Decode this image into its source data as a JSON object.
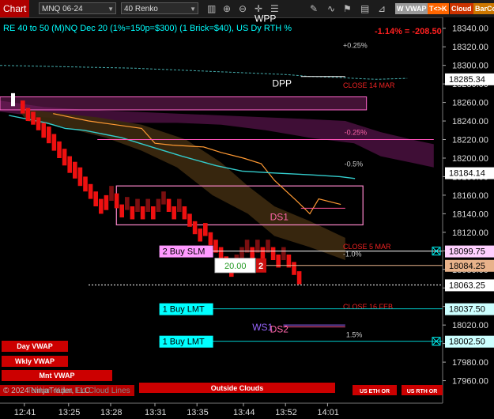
{
  "toolbar": {
    "tab_label": "Chart",
    "instrument": "MNQ 06-24",
    "bar_type": "40 Renko",
    "icons": [
      "bar-chart-icon",
      "zoom-in-icon",
      "zoom-out-icon",
      "crosshair-icon",
      "properties-icon",
      "pencil-icon",
      "indicator-icon",
      "strategy-icon",
      "template-icon",
      "pin-icon"
    ],
    "buttons": [
      {
        "label": "W VWAP",
        "color": "#9a9a9a"
      },
      {
        "label": "T<>K",
        "color": "#ff6600"
      },
      {
        "label": "Cloud",
        "color": "#cc3300"
      },
      {
        "label": "BarCo",
        "color": "#cc7700"
      }
    ]
  },
  "chart_data": {
    "type": "renko",
    "title": "RE 40 to 50 (M)NQ Dec 20 (1%=150p=$300) (1 Brick=$40), US Dy RTH %",
    "change_text": "-1.14% = -208.50",
    "ylim": [
      17940,
      18350
    ],
    "y_ticks": [
      17960,
      17980,
      18000,
      18020,
      18040,
      18060,
      18080,
      18100,
      18120,
      18140,
      18160,
      18180,
      18200,
      18220,
      18240,
      18260,
      18280,
      18300,
      18320,
      18340
    ],
    "x_tick_labels": [
      "12:41",
      "13:25",
      "13:28",
      "13:31",
      "13:35",
      "13:44",
      "13:52",
      "14:01"
    ],
    "bricks": [
      {
        "o": 18262,
        "c": 18248,
        "color": "red"
      },
      {
        "o": 18254,
        "c": 18240,
        "color": "red"
      },
      {
        "o": 18250,
        "c": 18236,
        "color": "red"
      },
      {
        "o": 18244,
        "c": 18230,
        "color": "red"
      },
      {
        "o": 18238,
        "c": 18222,
        "color": "red"
      },
      {
        "o": 18234,
        "c": 18216,
        "color": "red"
      },
      {
        "o": 18226,
        "c": 18208,
        "color": "red"
      },
      {
        "o": 18218,
        "c": 18200,
        "color": "red"
      },
      {
        "o": 18210,
        "c": 18192,
        "color": "red"
      },
      {
        "o": 18202,
        "c": 18184,
        "color": "red"
      },
      {
        "o": 18196,
        "c": 18178,
        "color": "red"
      },
      {
        "o": 18190,
        "c": 18170,
        "color": "red"
      },
      {
        "o": 18180,
        "c": 18164,
        "color": "red"
      },
      {
        "o": 18172,
        "c": 18156,
        "color": "red"
      },
      {
        "o": 18164,
        "c": 18148,
        "color": "red"
      },
      {
        "o": 18156,
        "c": 18140,
        "color": "red"
      },
      {
        "o": 18160,
        "c": 18144,
        "color": "red"
      },
      {
        "o": 18170,
        "c": 18154,
        "color": "darkred"
      },
      {
        "o": 18162,
        "c": 18146,
        "color": "red"
      },
      {
        "o": 18150,
        "c": 18136,
        "color": "red"
      },
      {
        "o": 18158,
        "c": 18144,
        "color": "darkred"
      },
      {
        "o": 18148,
        "c": 18134,
        "color": "red"
      },
      {
        "o": 18156,
        "c": 18142,
        "color": "darkred"
      },
      {
        "o": 18148,
        "c": 18134,
        "color": "red"
      },
      {
        "o": 18156,
        "c": 18142,
        "color": "darkred"
      },
      {
        "o": 18148,
        "c": 18134,
        "color": "red"
      },
      {
        "o": 18156,
        "c": 18142,
        "color": "darkred"
      },
      {
        "o": 18164,
        "c": 18150,
        "color": "darkred"
      },
      {
        "o": 18156,
        "c": 18142,
        "color": "red"
      },
      {
        "o": 18148,
        "c": 18134,
        "color": "red"
      },
      {
        "o": 18156,
        "c": 18142,
        "color": "darkred"
      },
      {
        "o": 18148,
        "c": 18134,
        "color": "red"
      },
      {
        "o": 18140,
        "c": 18126,
        "color": "red"
      },
      {
        "o": 18132,
        "c": 18118,
        "color": "red"
      },
      {
        "o": 18124,
        "c": 18110,
        "color": "red"
      },
      {
        "o": 18130,
        "c": 18116,
        "color": "red"
      },
      {
        "o": 18120,
        "c": 18106,
        "color": "red"
      },
      {
        "o": 18112,
        "c": 18098,
        "color": "red"
      },
      {
        "o": 18104,
        "c": 18090,
        "color": "red"
      },
      {
        "o": 18094,
        "c": 18080,
        "color": "red"
      },
      {
        "o": 18086,
        "c": 18072,
        "color": "red"
      },
      {
        "o": 18096,
        "c": 18082,
        "color": "darkred"
      },
      {
        "o": 18104,
        "c": 18090,
        "color": "darkred"
      },
      {
        "o": 18112,
        "c": 18098,
        "color": "darkred"
      },
      {
        "o": 18104,
        "c": 18090,
        "color": "red"
      },
      {
        "o": 18112,
        "c": 18098,
        "color": "darkred"
      },
      {
        "o": 18104,
        "c": 18090,
        "color": "red"
      },
      {
        "o": 18112,
        "c": 18098,
        "color": "darkred"
      },
      {
        "o": 18104,
        "c": 18090,
        "color": "red"
      },
      {
        "o": 18096,
        "c": 18082,
        "color": "red"
      },
      {
        "o": 18104,
        "c": 18090,
        "color": "darkred"
      },
      {
        "o": 18096,
        "c": 18082,
        "color": "red"
      },
      {
        "o": 18088,
        "c": 18074,
        "color": "red"
      },
      {
        "o": 18078,
        "c": 18064,
        "color": "red"
      }
    ],
    "price_tags": [
      {
        "price": 18285.34,
        "label": "18285.34",
        "bg": "#ffffff",
        "fg": "#000000"
      },
      {
        "price": 18184.14,
        "label": "18184.14",
        "bg": "#ffffff",
        "fg": "#000000"
      },
      {
        "price": 18099.75,
        "label": "18099.75",
        "bg": "#ffd0ff",
        "fg": "#000000"
      },
      {
        "price": 18084.25,
        "label": "18084.25",
        "bg": "#e8b28a",
        "fg": "#000000"
      },
      {
        "price": 18063.25,
        "label": "18063.25",
        "bg": "#ffffff",
        "fg": "#000000"
      },
      {
        "price": 18037.5,
        "label": "18037.50",
        "bg": "#ccffff",
        "fg": "#000000"
      },
      {
        "price": 18002.5,
        "label": "18002.50",
        "bg": "#ccffff",
        "fg": "#000000"
      }
    ],
    "level_labels": [
      {
        "text": "WPP",
        "price": 18347,
        "x": 0.575,
        "color": "#ffffff"
      },
      {
        "text": "DPP",
        "price": 18277,
        "x": 0.615,
        "color": "#ffffff"
      },
      {
        "text": "DS1",
        "price": 18133,
        "x": 0.61,
        "color": "#ff66aa"
      },
      {
        "text": "WS1",
        "price": 18014,
        "x": 0.57,
        "color": "#9966ff"
      },
      {
        "text": "DS2",
        "price": 18012,
        "x": 0.61,
        "color": "#ff66aa"
      },
      {
        "text": "CLOSE 14 MAR",
        "price": 18276,
        "x": 0.775,
        "color": "#ee2222"
      },
      {
        "text": "CLOSE 5 MAR",
        "price": 18102,
        "x": 0.775,
        "color": "#ee2222"
      },
      {
        "text": "CLOSE 16 FEB",
        "price": 18037,
        "x": 0.775,
        "color": "#ee2222"
      },
      {
        "text": "+0.25%",
        "price": 18319,
        "x": 0.775,
        "color": "#cccccc"
      },
      {
        "text": "-0.25%",
        "price": 18225,
        "x": 0.778,
        "color": "#ff66aa"
      },
      {
        "text": "-0.5%",
        "price": 18191,
        "x": 0.778,
        "color": "#cccccc"
      },
      {
        "text": "-1.0%",
        "price": 18094,
        "x": 0.775,
        "color": "#cccccc"
      },
      {
        "text": "1.5%",
        "price": 18007,
        "x": 0.782,
        "color": "#cccccc"
      }
    ],
    "orders": [
      {
        "label": "2 Buy SLM",
        "price": 18099.75,
        "bg": "#ff99ff",
        "line": "#ffffff",
        "cancel_icon": true
      },
      {
        "label": "1 Buy LMT",
        "price": 18037.5,
        "bg": "#00ffff",
        "line": "#00cccc",
        "cancel_icon": false
      },
      {
        "label": "1 Buy LMT",
        "price": 18002.5,
        "bg": "#00ffff",
        "line": "#00cccc",
        "cancel_icon": true
      }
    ],
    "position": {
      "qty_text": "20.00",
      "count_text": "2",
      "price": 18084.25
    },
    "vwap_buttons": [
      "Day VWAP",
      "Wkly VWAP",
      "Mnt VWAP"
    ],
    "bottom_buttons": [
      "Outside Clouds",
      "US ETH OR",
      "US RTH OR"
    ],
    "footer": "© 2024 NinjaTrader, LLC",
    "watermark": "Tenkan-Kijun Ext Cloud Lines",
    "tenkan": [
      [
        0,
        18248
      ],
      [
        0.08,
        18240
      ],
      [
        0.14,
        18236
      ],
      [
        0.2,
        18232
      ],
      [
        0.23,
        18216
      ],
      [
        0.27,
        18214
      ],
      [
        0.34,
        18212
      ],
      [
        0.38,
        18206
      ],
      [
        0.43,
        18200
      ],
      [
        0.47,
        18194
      ],
      [
        0.5,
        18176
      ],
      [
        0.55,
        18154
      ],
      [
        0.58,
        18140
      ],
      [
        0.6,
        18156
      ],
      [
        0.65,
        18150
      ],
      [
        0.72,
        18140
      ],
      [
        0.8,
        18128
      ],
      [
        0.88,
        18115
      ],
      [
        0.92,
        18108
      ]
    ],
    "kijun": [
      [
        0,
        18252
      ],
      [
        0.05,
        18248
      ],
      [
        0.1,
        18244
      ],
      [
        0.15,
        18238
      ],
      [
        0.2,
        18236
      ],
      [
        0.3,
        18228
      ],
      [
        0.38,
        18218
      ],
      [
        0.46,
        18208
      ],
      [
        0.55,
        18198
      ],
      [
        0.62,
        18192
      ],
      [
        0.7,
        18190
      ],
      [
        0.8,
        18188
      ],
      [
        0.88,
        18186
      ],
      [
        0.92,
        18184
      ]
    ],
    "pp_line": [
      [
        0.0,
        18300
      ],
      [
        0.3,
        18297
      ],
      [
        0.55,
        18292
      ],
      [
        0.65,
        18290
      ],
      [
        0.7,
        18288
      ],
      [
        0.76,
        18287
      ],
      [
        0.8,
        18286
      ],
      [
        0.85,
        18285
      ],
      [
        0.92,
        18286
      ]
    ]
  }
}
